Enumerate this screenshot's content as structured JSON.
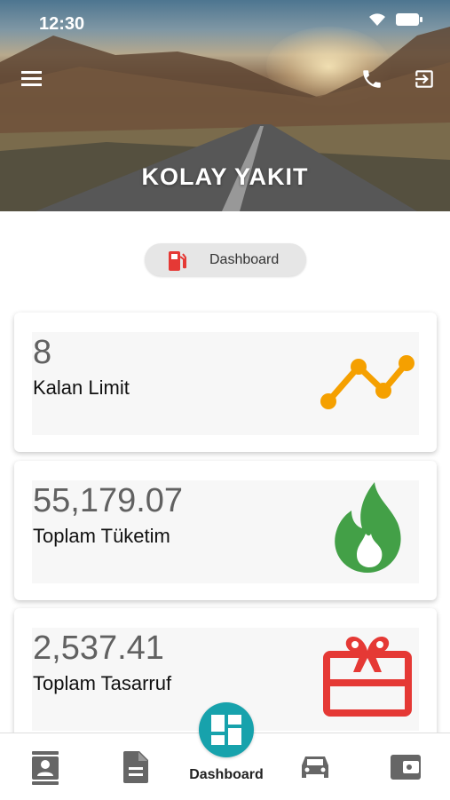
{
  "status_bar": {
    "time": "12:30"
  },
  "header": {
    "title": "KOLAY YAKIT",
    "icons": [
      "menu-icon",
      "phone-icon",
      "logout-icon"
    ]
  },
  "page_chip": {
    "label": "Dashboard",
    "icon": "fuel-pump-icon"
  },
  "cards": [
    {
      "value": "8",
      "label": "Kalan Limit",
      "icon": "trend-line-icon",
      "icon_color": "#f5a000"
    },
    {
      "value": "55,179.07",
      "label": "Toplam Tüketim",
      "icon": "flame-icon",
      "icon_color": "#43a047"
    },
    {
      "value": "2,537.41",
      "label": "Toplam Tasarruf",
      "icon": "gift-card-icon",
      "icon_color": "#e53935"
    }
  ],
  "bottom_nav": {
    "items": [
      "contact-card-icon",
      "document-icon",
      "dashboard-icon",
      "car-icon",
      "wallet-icon"
    ],
    "active_label": "Dashboard",
    "active_color": "#17a2ac"
  }
}
